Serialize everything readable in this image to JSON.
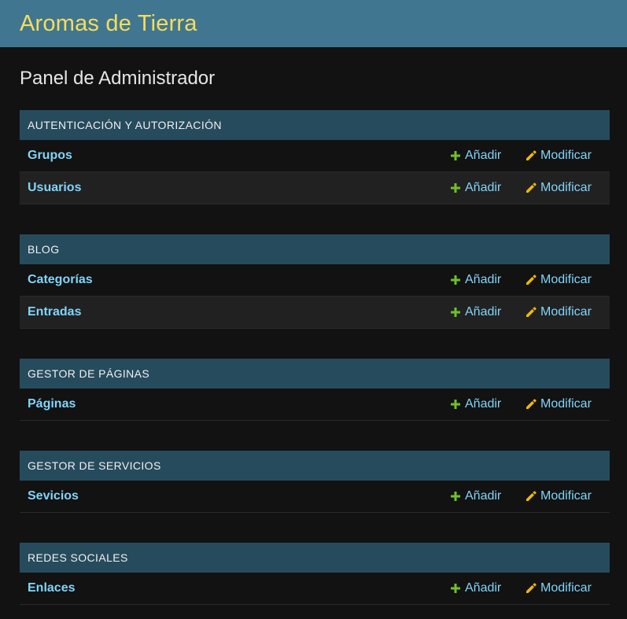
{
  "header": {
    "site_title": "Aromas de Tierra"
  },
  "page": {
    "title": "Panel de Administrador"
  },
  "colors": {
    "header_bg": "#417690",
    "site_title": "#f5dd5d",
    "module_caption_bg": "#264b5d",
    "link": "#81d4fa",
    "add_icon": "#70bf2b",
    "change_icon": "#efb80b"
  },
  "icons": {
    "add": "plus-icon",
    "change": "pencil-icon"
  },
  "modules": [
    {
      "caption": "AUTENTICACIÓN Y AUTORIZACIÓN",
      "models": [
        {
          "name": "Grupos",
          "add_label": "Añadir",
          "change_label": "Modificar"
        },
        {
          "name": "Usuarios",
          "add_label": "Añadir",
          "change_label": "Modificar"
        }
      ]
    },
    {
      "caption": "BLOG",
      "models": [
        {
          "name": "Categorías",
          "add_label": "Añadir",
          "change_label": "Modificar"
        },
        {
          "name": "Entradas",
          "add_label": "Añadir",
          "change_label": "Modificar"
        }
      ]
    },
    {
      "caption": "GESTOR DE PÁGINAS",
      "models": [
        {
          "name": "Páginas",
          "add_label": "Añadir",
          "change_label": "Modificar"
        }
      ]
    },
    {
      "caption": "GESTOR DE SERVICIOS",
      "models": [
        {
          "name": "Sevicios",
          "add_label": "Añadir",
          "change_label": "Modificar"
        }
      ]
    },
    {
      "caption": "REDES SOCIALES",
      "models": [
        {
          "name": "Enlaces",
          "add_label": "Añadir",
          "change_label": "Modificar"
        }
      ]
    }
  ]
}
